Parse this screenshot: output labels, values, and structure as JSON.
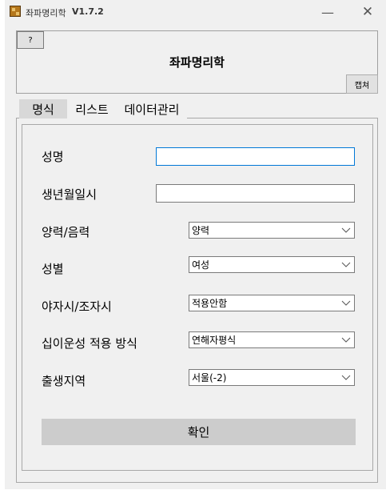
{
  "window": {
    "title": "좌파명리학",
    "version": "V1.7.2",
    "minimize_glyph": "—",
    "close_glyph": "✕",
    "icon": "app-icon"
  },
  "header": {
    "help_label": "?",
    "app_title": "좌파명리학",
    "capture_label": "캡쳐"
  },
  "tabs": [
    {
      "label": "명식",
      "selected": true
    },
    {
      "label": "리스트",
      "selected": false
    },
    {
      "label": "데이터관리",
      "selected": false
    }
  ],
  "form": {
    "name_label": "성명",
    "name_value": "",
    "birth_label": "생년월일시",
    "birth_value": "",
    "calendar_label": "양력/음력",
    "calendar_value": "양력",
    "gender_label": "성별",
    "gender_value": "여성",
    "night_label": "야자시/조자시",
    "night_value": "적용안함",
    "twelve_label": "십이운성 적용 방식",
    "twelve_value": "연해자평식",
    "region_label": "출생지역",
    "region_value": "서울(-2)",
    "confirm_label": "확인"
  },
  "colors": {
    "window_bg": "#f0f0f0",
    "focus_border": "#0078d7",
    "button_bg": "#cccccc",
    "selected_tab_bg": "#d8d8d8"
  }
}
